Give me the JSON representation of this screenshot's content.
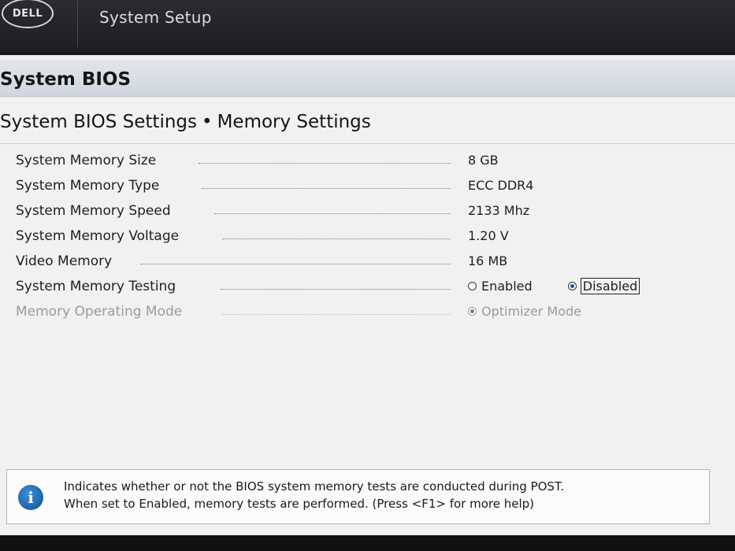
{
  "topbar": {
    "logo_text": "DELL",
    "app_title": "System Setup"
  },
  "header": {
    "page_title": "System BIOS"
  },
  "breadcrumb": {
    "parent": "System BIOS Settings",
    "separator": "•",
    "current": "Memory Settings"
  },
  "settings": {
    "rows": [
      {
        "label": "System Memory Size",
        "value": "8 GB"
      },
      {
        "label": "System Memory Type",
        "value": "ECC DDR4"
      },
      {
        "label": "System Memory Speed",
        "value": "2133 Mhz"
      },
      {
        "label": "System Memory Voltage",
        "value": "1.20 V"
      },
      {
        "label": "Video Memory",
        "value": "16 MB"
      }
    ],
    "memory_testing": {
      "label": "System Memory Testing",
      "option_enabled": "Enabled",
      "option_disabled": "Disabled",
      "selected": "Disabled"
    },
    "operating_mode": {
      "label": "Memory Operating Mode",
      "option": "Optimizer Mode",
      "state": "greyed-out"
    }
  },
  "help": {
    "icon": "info-icon",
    "line1": "Indicates whether or not the BIOS system memory tests are conducted during POST.",
    "line2": "When set to Enabled, memory tests are performed. (Press <F1> for more help)"
  },
  "colors": {
    "accent": "#1e4fa8",
    "header_band": "#cfd6dd",
    "background": "#f1f1f1"
  }
}
